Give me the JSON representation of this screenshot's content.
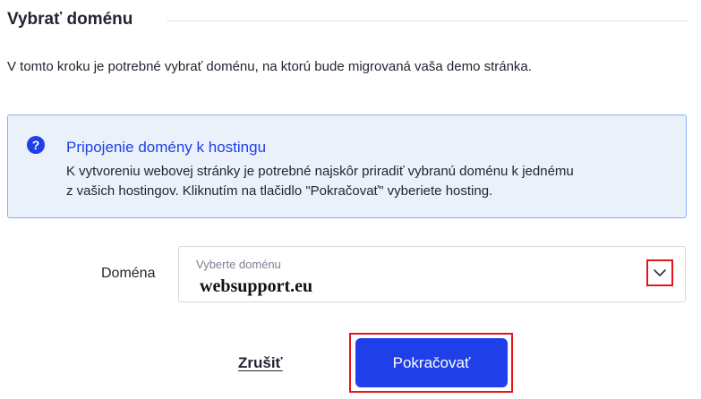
{
  "section": {
    "title": "Vybrať doménu",
    "intro": "V tomto kroku je potrebné vybrať doménu, na ktorú bude migrovaná vaša demo stránka."
  },
  "info_box": {
    "icon": "help-icon",
    "title": "Pripojenie domény k hostingu",
    "body_line1": "K vytvoreniu webovej stránky je potrebné najskôr priradiť vybranú doménu k jednému",
    "body_line2": "z vašich hostingov. Kliknutím na tlačidlo \"Pokračovať\" vyberiete hosting."
  },
  "domain_field": {
    "label": "Doména",
    "placeholder": "Vyberte doménu",
    "value": "websupport.eu",
    "toggle_icon": "chevron-down-icon"
  },
  "actions": {
    "cancel_label": "Zrušiť",
    "continue_label": "Pokračovať"
  },
  "colors": {
    "accent": "#1f3fe8",
    "info_background": "#eaf1fb",
    "info_border": "#8aaeea",
    "highlight": "#e5141a",
    "text": "#222631"
  }
}
